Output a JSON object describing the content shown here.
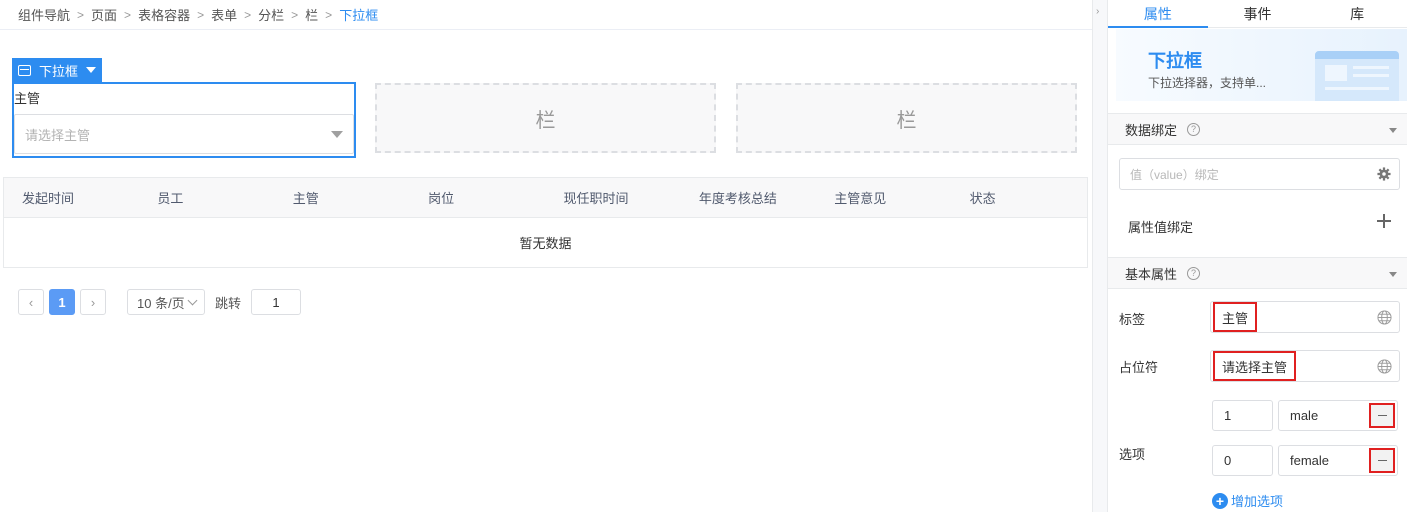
{
  "breadcrumb": {
    "items": [
      "组件导航",
      "页面",
      "表格容器",
      "表单",
      "分栏",
      "栏",
      "下拉框"
    ],
    "separator": ">"
  },
  "canvas": {
    "component_tag": "下拉框",
    "form_item": {
      "label": "主管",
      "placeholder": "请选择主管"
    },
    "column_placeholders": [
      "栏",
      "栏"
    ],
    "table": {
      "columns": [
        "发起时间",
        "员工",
        "主管",
        "岗位",
        "现任职时间",
        "年度考核总结",
        "主管意见",
        "状态"
      ],
      "empty_text": "暂无数据"
    },
    "pager": {
      "prev": "‹",
      "next": "›",
      "current_page": "1",
      "page_size": "10 条/页",
      "jump_label": "跳转",
      "jump_value": "1"
    }
  },
  "panel": {
    "tabs": [
      "属性",
      "事件",
      "库"
    ],
    "active_tab": "属性",
    "hero": {
      "title": "下拉框",
      "desc": "下拉选择器，支持单..."
    },
    "data_binding": {
      "title": "数据绑定",
      "help": "?",
      "value_placeholder": "值（value）绑定",
      "attr_binding_label": "属性值绑定"
    },
    "basic": {
      "title": "基本属性",
      "help": "?",
      "label_field": {
        "label": "标签",
        "value": "主管"
      },
      "placeholder_field": {
        "label": "占位符",
        "value": "请选择主管"
      },
      "options_label": "选项",
      "options": [
        {
          "value": "1",
          "label": "male"
        },
        {
          "value": "0",
          "label": "female"
        }
      ],
      "add_option": "增加选项"
    }
  },
  "colors": {
    "accent": "#2d8cf0",
    "highlight": "#e02020",
    "page_active": "#5b9bf5"
  }
}
